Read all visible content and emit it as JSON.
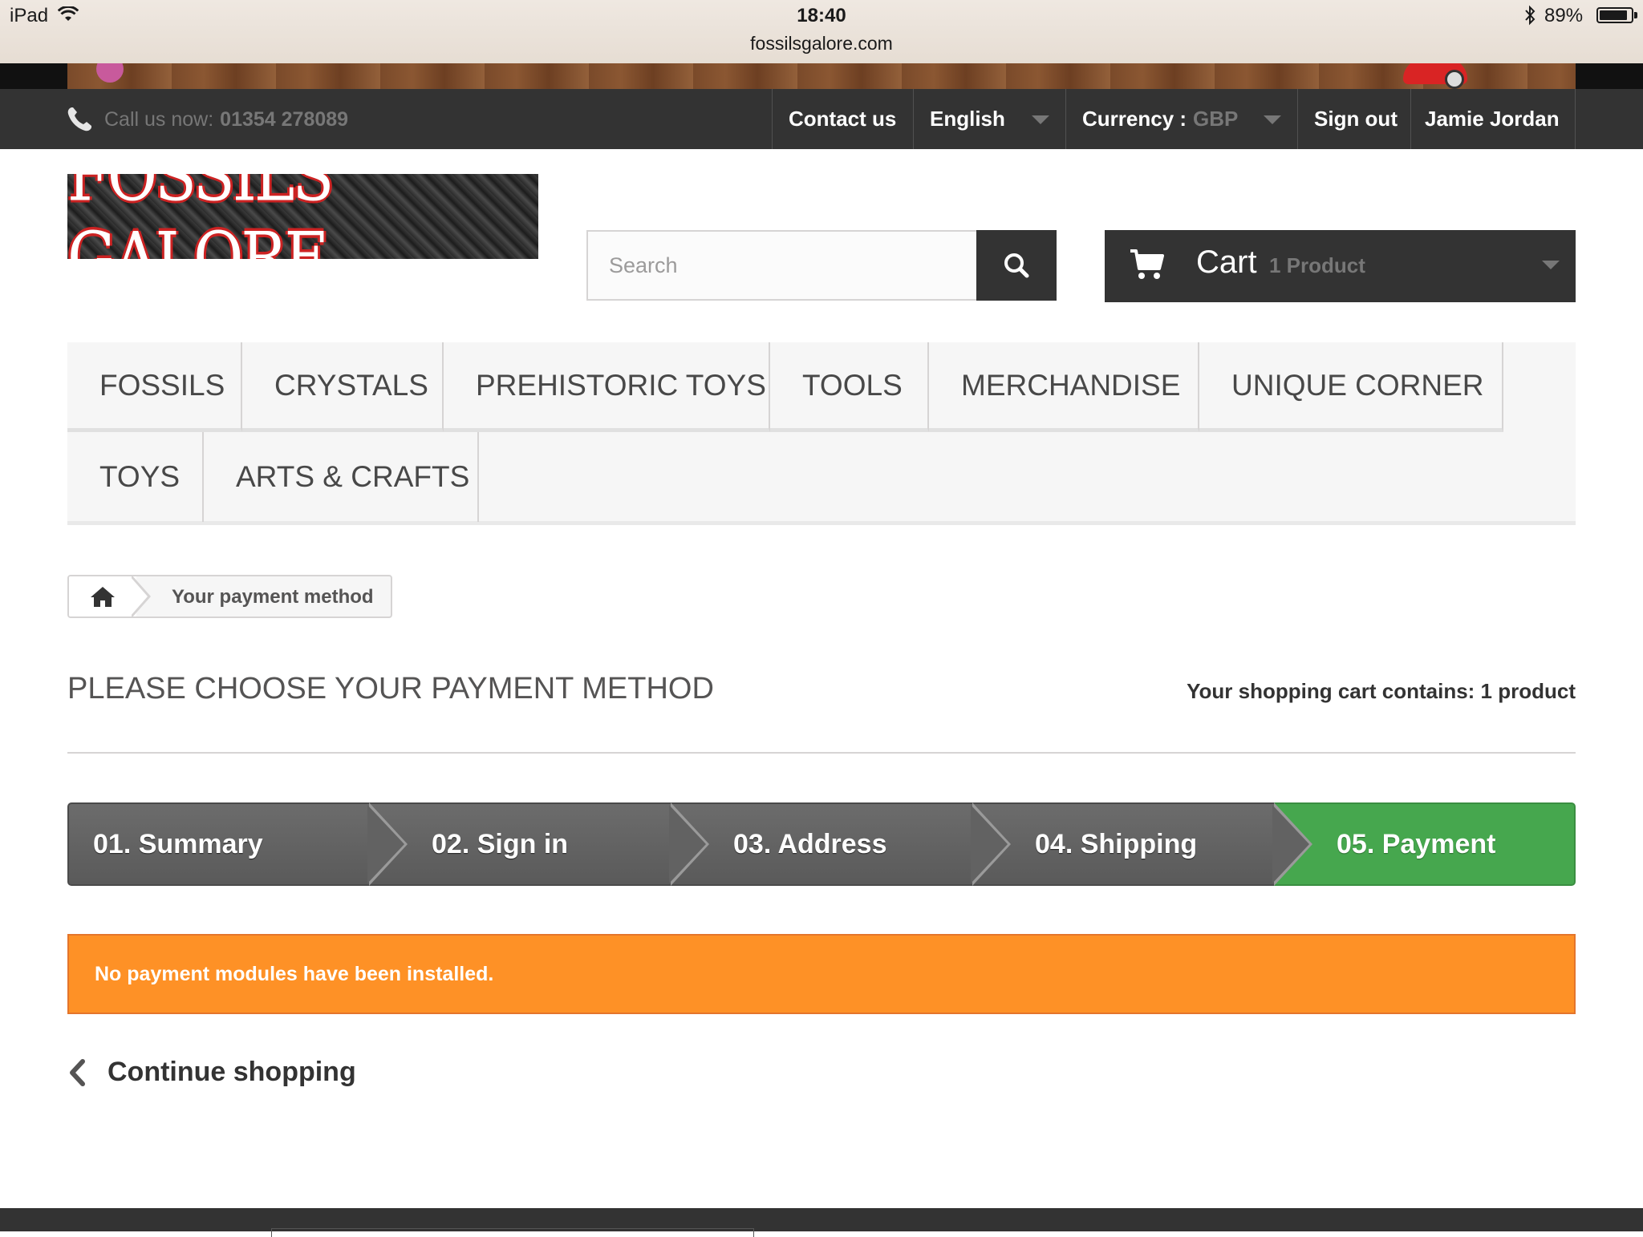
{
  "status_bar": {
    "device": "iPad",
    "time": "18:40",
    "url": "fossilsgalore.com",
    "battery_text": "89%",
    "battery_level": 0.89,
    "icons": [
      "wifi-icon",
      "bluetooth-icon",
      "battery-icon"
    ]
  },
  "top_nav": {
    "call_label": "Call us now:",
    "phone": "01354 278089",
    "contact": "Contact us",
    "language": "English",
    "currency_label": "Currency :",
    "currency_value": "GBP",
    "sign_out": "Sign out",
    "user_name": "Jamie Jordan"
  },
  "header": {
    "logo_text": "FOSSILS GALORE",
    "search_placeholder": "Search",
    "cart_label": "Cart",
    "cart_count": "1 Product"
  },
  "menu": {
    "items": [
      "Fossils",
      "Crystals",
      "Prehistoric Toys",
      "Tools",
      "Merchandise",
      "Unique Corner",
      "Toys",
      "Arts & Crafts"
    ]
  },
  "breadcrumb": {
    "current": "Your payment method"
  },
  "page": {
    "title": "Please choose your payment method",
    "cart_summary": "Your shopping cart contains: 1 product"
  },
  "steps": [
    "01. Summary",
    "02. Sign in",
    "03. Address",
    "04. Shipping",
    "05. Payment"
  ],
  "active_step": 4,
  "alert": {
    "message": "No payment modules have been installed."
  },
  "actions": {
    "continue_shopping": "Continue shopping"
  },
  "colors": {
    "dark_bar": "#333333",
    "step_gray": "#626262",
    "step_active": "#46a74e",
    "alert_orange": "#fe9126",
    "menu_bg": "#f6f6f6"
  }
}
